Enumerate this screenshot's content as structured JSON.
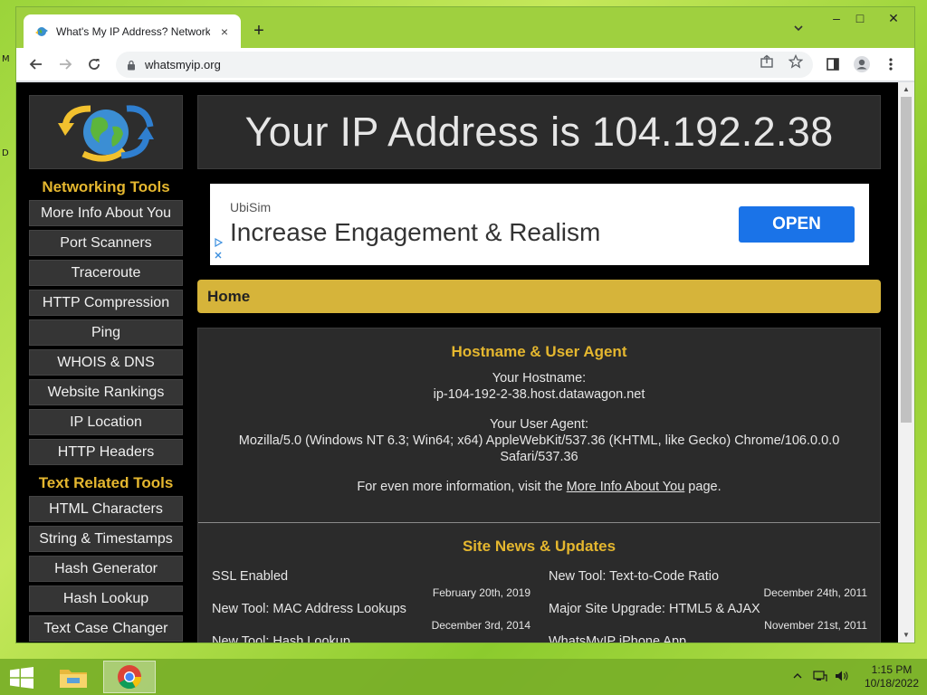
{
  "browser": {
    "tab_title": "What's My IP Address? Networking Tools & More",
    "tab_close": "×",
    "new_tab": "+",
    "url": "whatsmyip.org",
    "window_controls": {
      "minimize": "–",
      "maximize": "□",
      "close": "✕"
    }
  },
  "sidebar": {
    "networking_heading": "Networking Tools",
    "networking_items": [
      "More Info About You",
      "Port Scanners",
      "Traceroute",
      "HTTP Compression",
      "Ping",
      "WHOIS & DNS",
      "Website Rankings",
      "IP Location",
      "HTTP Headers"
    ],
    "text_heading": "Text Related Tools",
    "text_items": [
      "HTML Characters",
      "String & Timestamps",
      "Hash Generator",
      "Hash Lookup",
      "Text Case Changer"
    ]
  },
  "main": {
    "banner_title": "Your IP Address is 104.192.2.38",
    "ad": {
      "advertiser": "UbiSim",
      "headline": "Increase Engagement & Realism",
      "cta": "OPEN"
    },
    "breadcrumb": "Home",
    "hostname_section": {
      "title": "Hostname & User Agent",
      "hostname_label": "Your Hostname:",
      "hostname_value": "ip-104-192-2-38.host.datawagon.net",
      "ua_label": "Your User Agent:",
      "ua_value_line1": "Mozilla/5.0 (Windows NT 6.3; Win64; x64) AppleWebKit/537.36 (KHTML, like Gecko) Chrome/106.0.0.0",
      "ua_value_line2": "Safari/537.36",
      "more_prefix": "For even more information, visit the ",
      "more_link": "More Info About You",
      "more_suffix": " page."
    },
    "news": {
      "title": "Site News & Updates",
      "left": [
        {
          "title": "SSL Enabled",
          "date": "February 20th, 2019"
        },
        {
          "title": "New Tool: MAC Address Lookups",
          "date": "December 3rd, 2014"
        },
        {
          "title": "New Tool: Hash Lookup",
          "date": ""
        }
      ],
      "right": [
        {
          "title": "New Tool: Text-to-Code Ratio",
          "date": "December 24th, 2011"
        },
        {
          "title": "Major Site Upgrade: HTML5 & AJAX",
          "date": "November 21st, 2011"
        },
        {
          "title": "WhatsMyIP iPhone App",
          "date": ""
        }
      ]
    }
  },
  "taskbar": {
    "time": "1:15 PM",
    "date": "10/18/2022"
  },
  "colors": {
    "accent_gold": "#e5b72f",
    "breadcrumb_bg": "#d6b43a",
    "ad_button": "#1a73e8",
    "page_bg": "#000000"
  },
  "icons": {
    "tab_favicon": "globe-icon",
    "back": "back-arrow-icon",
    "forward": "forward-arrow-icon",
    "reload": "reload-icon",
    "lock": "lock-icon",
    "share": "share-icon",
    "bookmark": "star-icon",
    "sidepanel": "side-panel-icon",
    "profile": "profile-icon",
    "menu": "kebab-menu-icon"
  }
}
